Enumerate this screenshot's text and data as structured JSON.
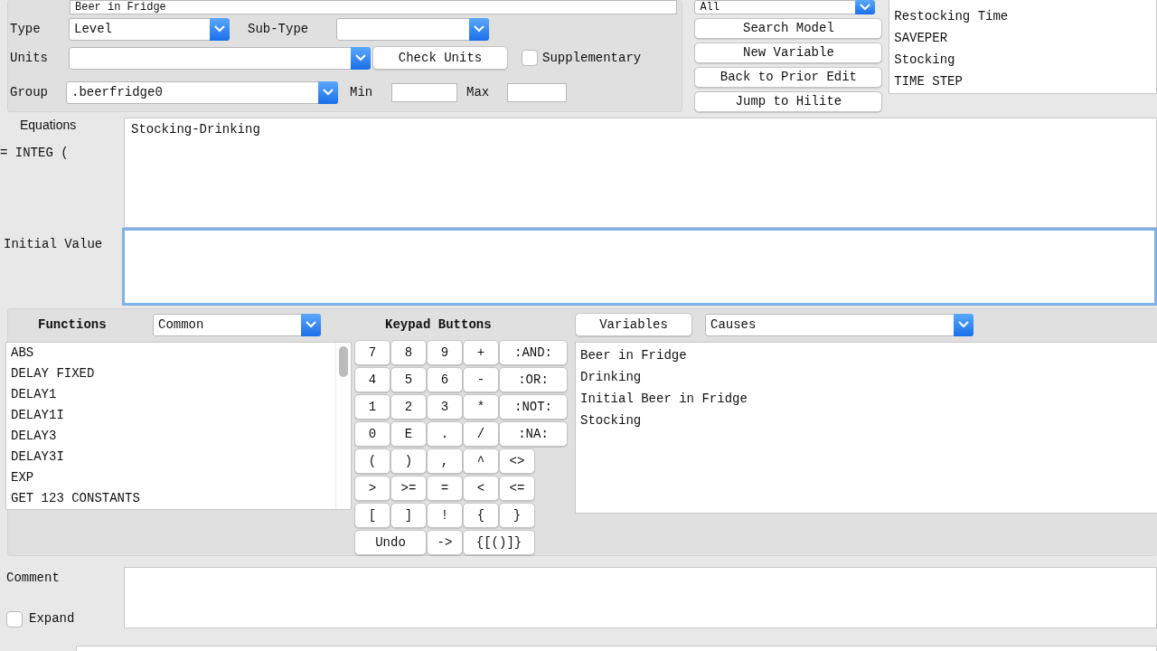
{
  "name_field": {
    "value": "Beer in Fridge"
  },
  "type": {
    "label": "Type",
    "value": "Level"
  },
  "subtype": {
    "label": "Sub-Type"
  },
  "units": {
    "label": "Units",
    "button": "Check Units"
  },
  "supplementary": {
    "label": "Supplementary",
    "checked": false
  },
  "group": {
    "label": "Group",
    "value": ".beerfridge0"
  },
  "min": {
    "label": "Min"
  },
  "max": {
    "label": "Max"
  },
  "filter": {
    "value": "All"
  },
  "actions": [
    "Search Model",
    "New Variable",
    "Back to Prior Edit",
    "Jump to Hilite"
  ],
  "model_variables": [
    "Restocking Time",
    "SAVEPER",
    "Stocking",
    "TIME STEP"
  ],
  "equations": {
    "label": "Equations",
    "prefix": "= INTEG (",
    "value": "Stocking-Drinking"
  },
  "initial_value": {
    "label": "Initial Value",
    "focused": true
  },
  "functions": {
    "label": "Functions",
    "category": "Common",
    "items": [
      "ABS",
      "DELAY FIXED",
      "DELAY1",
      "DELAY1I",
      "DELAY3",
      "DELAY3I",
      "EXP",
      "GET 123 CONSTANTS"
    ]
  },
  "keypad": {
    "label": "Keypad Buttons",
    "rows": [
      [
        {
          "label": "7",
          "kind": "narrow"
        },
        {
          "label": "8",
          "kind": "narrow"
        },
        {
          "label": "9",
          "kind": "narrow"
        },
        {
          "label": "+",
          "kind": "narrow"
        },
        {
          "label": ":AND:",
          "kind": "wide"
        }
      ],
      [
        {
          "label": "4",
          "kind": "narrow"
        },
        {
          "label": "5",
          "kind": "narrow"
        },
        {
          "label": "6",
          "kind": "narrow"
        },
        {
          "label": "-",
          "kind": "narrow"
        },
        {
          "label": ":OR:",
          "kind": "wide"
        }
      ],
      [
        {
          "label": "1",
          "kind": "narrow"
        },
        {
          "label": "2",
          "kind": "narrow"
        },
        {
          "label": "3",
          "kind": "narrow"
        },
        {
          "label": "*",
          "kind": "narrow"
        },
        {
          "label": ":NOT:",
          "kind": "wide"
        }
      ],
      [
        {
          "label": "0",
          "kind": "narrow"
        },
        {
          "label": "E",
          "kind": "narrow"
        },
        {
          "label": ".",
          "kind": "narrow"
        },
        {
          "label": "/",
          "kind": "narrow"
        },
        {
          "label": ":NA:",
          "kind": "wide"
        }
      ],
      [
        {
          "label": "(",
          "kind": "narrow"
        },
        {
          "label": ")",
          "kind": "narrow"
        },
        {
          "label": ",",
          "kind": "narrow"
        },
        {
          "label": "^",
          "kind": "narrow"
        },
        {
          "label": "<>",
          "kind": "narrow"
        }
      ],
      [
        {
          "label": ">",
          "kind": "narrow"
        },
        {
          "label": ">=",
          "kind": "narrow"
        },
        {
          "label": "=",
          "kind": "narrow"
        },
        {
          "label": "<",
          "kind": "narrow"
        },
        {
          "label": "<=",
          "kind": "narrow"
        }
      ],
      [
        {
          "label": "[",
          "kind": "narrow"
        },
        {
          "label": "]",
          "kind": "narrow"
        },
        {
          "label": "!",
          "kind": "narrow"
        },
        {
          "label": "{",
          "kind": "narrow"
        },
        {
          "label": "}",
          "kind": "narrow"
        }
      ]
    ],
    "edit_keys": [
      {
        "label": "Undo",
        "kind": "wide"
      },
      {
        "label": "->",
        "kind": "narrow"
      },
      {
        "label": "{[()]}",
        "kind": "wide"
      }
    ]
  },
  "variables": {
    "button": "Variables",
    "mode": "Causes",
    "items": [
      "Beer in Fridge",
      "Drinking",
      "Initial Beer in Fridge",
      "Stocking"
    ]
  },
  "comment": {
    "label": "Comment"
  },
  "expand": {
    "label": "Expand",
    "checked": false
  }
}
